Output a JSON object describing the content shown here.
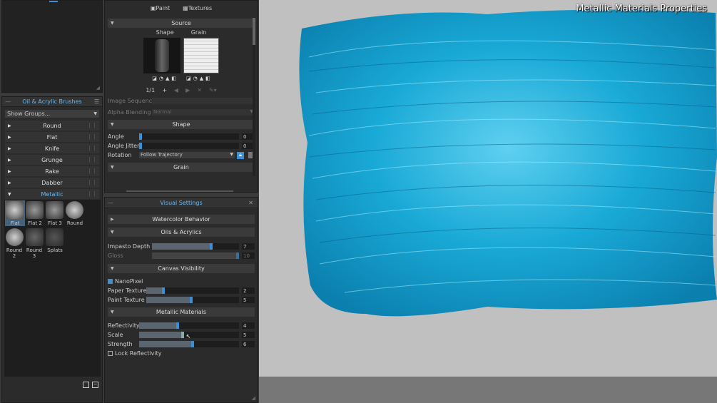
{
  "top_tabs": {
    "paint": "Paint",
    "textures": "Textures"
  },
  "source": {
    "title": "Source",
    "shape_label": "Shape",
    "grain_label": "Grain",
    "pager": "1/1",
    "image_sequence": "Image Sequence",
    "alpha_blending": "Alpha Blending",
    "alpha_value": "Normal"
  },
  "shape": {
    "title": "Shape",
    "angle_label": "Angle",
    "angle_value": "0",
    "angle_jitter_label": "Angle Jitter",
    "angle_jitter_value": "0",
    "rotation_label": "Rotation",
    "rotation_value": "Follow Trajectory"
  },
  "grain": {
    "title": "Grain"
  },
  "brushes": {
    "title": "Oil & Acrylic Brushes",
    "show_groups": "Show Groups...",
    "groups": [
      "Round",
      "Flat",
      "Knife",
      "Grunge",
      "Rake",
      "Dabber",
      "Metallic"
    ],
    "items": [
      "Flat",
      "Flat 2",
      "Flat 3",
      "Round",
      "Round 2",
      "Round 3",
      "Splats"
    ]
  },
  "visual": {
    "title": "Visual Settings",
    "watercolor": "Watercolor Behavior",
    "oils": "Oils & Acrylics",
    "impasto_label": "Impasto Depth",
    "impasto_value": "7",
    "impasto_level": 0.7,
    "gloss_label": "Gloss",
    "gloss_value": "10",
    "gloss_level": 1.0,
    "canvas_vis": "Canvas Visibility",
    "nanopixel": "NanoPixel",
    "paper_label": "Paper Texture",
    "paper_value": "2",
    "paper_level": 0.2,
    "paint_label": "Paint Texture",
    "paint_value": "5",
    "paint_level": 0.5,
    "metallic": "Metallic Materials",
    "reflect_label": "Reflectivity",
    "reflect_value": "4",
    "reflect_level": 0.4,
    "scale_label": "Scale",
    "scale_value": "5",
    "scale_level": 0.45,
    "strength_label": "Strength",
    "strength_value": "6",
    "strength_level": 0.55,
    "lock_reflect": "Lock Reflectivity"
  },
  "overlay_title": "Metallic Materials Properties",
  "colors": {
    "accent": "#3b8fd6",
    "paint": "#19a9d6",
    "canvas": "#c0c0c0"
  }
}
